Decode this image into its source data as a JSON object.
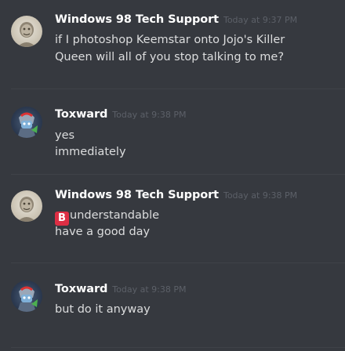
{
  "messages": [
    {
      "username": "Windows 98 Tech Support",
      "timestamp": "Today at 9:37 PM",
      "avatar": "windows98-avatar",
      "lines": [
        "if I photoshop Keemstar onto Jojo's Killer",
        "Queen will all of you stop talking to me?"
      ]
    },
    {
      "username": "Toxward",
      "timestamp": "Today at 9:38 PM",
      "avatar": "toxward-avatar",
      "lines": [
        "yes",
        "immediately"
      ]
    },
    {
      "username": "Windows 98 Tech Support",
      "timestamp": "Today at 9:38 PM",
      "avatar": "windows98-avatar",
      "emoji": "B",
      "lines": [
        "understandable",
        "have a good day"
      ]
    },
    {
      "username": "Toxward",
      "timestamp": "Today at 9:38 PM",
      "avatar": "toxward-avatar",
      "lines": [
        "but do it anyway"
      ]
    }
  ],
  "colors": {
    "background": "#36393f",
    "username": "#ffffff",
    "timestamp": "#5c6068",
    "text": "#dcddde",
    "emoji_b": "#dd2e44"
  }
}
